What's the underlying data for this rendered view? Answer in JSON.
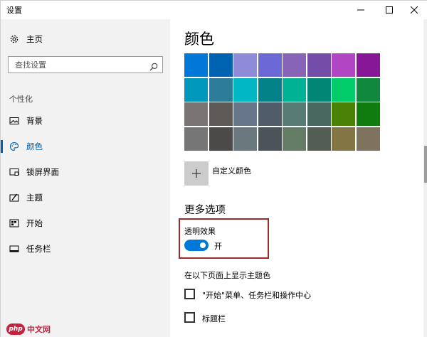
{
  "window": {
    "title": "设置",
    "controls": [
      "minimize",
      "maximize",
      "close"
    ]
  },
  "sidebar": {
    "home": {
      "label": "主页",
      "icon": "gear-icon"
    },
    "search": {
      "placeholder": "查找设置",
      "icon": "search-icon"
    },
    "section": "个性化",
    "items": [
      {
        "label": "背景",
        "icon": "image-icon",
        "active": false
      },
      {
        "label": "颜色",
        "icon": "palette-icon",
        "active": true
      },
      {
        "label": "锁屏界面",
        "icon": "lock-screen-icon",
        "active": false
      },
      {
        "label": "主题",
        "icon": "theme-icon",
        "active": false
      },
      {
        "label": "开始",
        "icon": "start-icon",
        "active": false
      },
      {
        "label": "任务栏",
        "icon": "taskbar-icon",
        "active": false
      }
    ]
  },
  "main": {
    "title": "颜色",
    "swatches": [
      [
        "#0078d7",
        "#0063b1",
        "#8e8cd8",
        "#6b69d6",
        "#8764b8",
        "#744da9",
        "#b146c2",
        "#881798"
      ],
      [
        "#0099bc",
        "#2d7d9a",
        "#00b7c3",
        "#038387",
        "#00b294",
        "#018574",
        "#00cc6a",
        "#10893e"
      ],
      [
        "#7a7574",
        "#5d5a58",
        "#68768a",
        "#515c6b",
        "#567c73",
        "#486860",
        "#498205",
        "#107c10"
      ],
      [
        "#767676",
        "#4c4a48",
        "#69797e",
        "#4a5459",
        "#647c64",
        "#525e54",
        "#847545",
        "#7e735f"
      ]
    ],
    "custom_color": {
      "label": "自定义颜色",
      "icon": "plus-icon"
    },
    "more_options": "更多选项",
    "transparency": {
      "label": "透明效果",
      "state": "开",
      "on": true
    },
    "show_accent": "在以下页面上显示主题色",
    "checkboxes": [
      {
        "label": "\"开始\"菜单、任务栏和操作中心",
        "checked": false
      },
      {
        "label": "标题栏",
        "checked": false
      }
    ]
  },
  "watermark": {
    "logo": "php",
    "text": "中文网"
  },
  "colors": {
    "accent": "#0063b1",
    "toggle_on": "#0078d7",
    "highlight_border": "#9e2a2a"
  }
}
